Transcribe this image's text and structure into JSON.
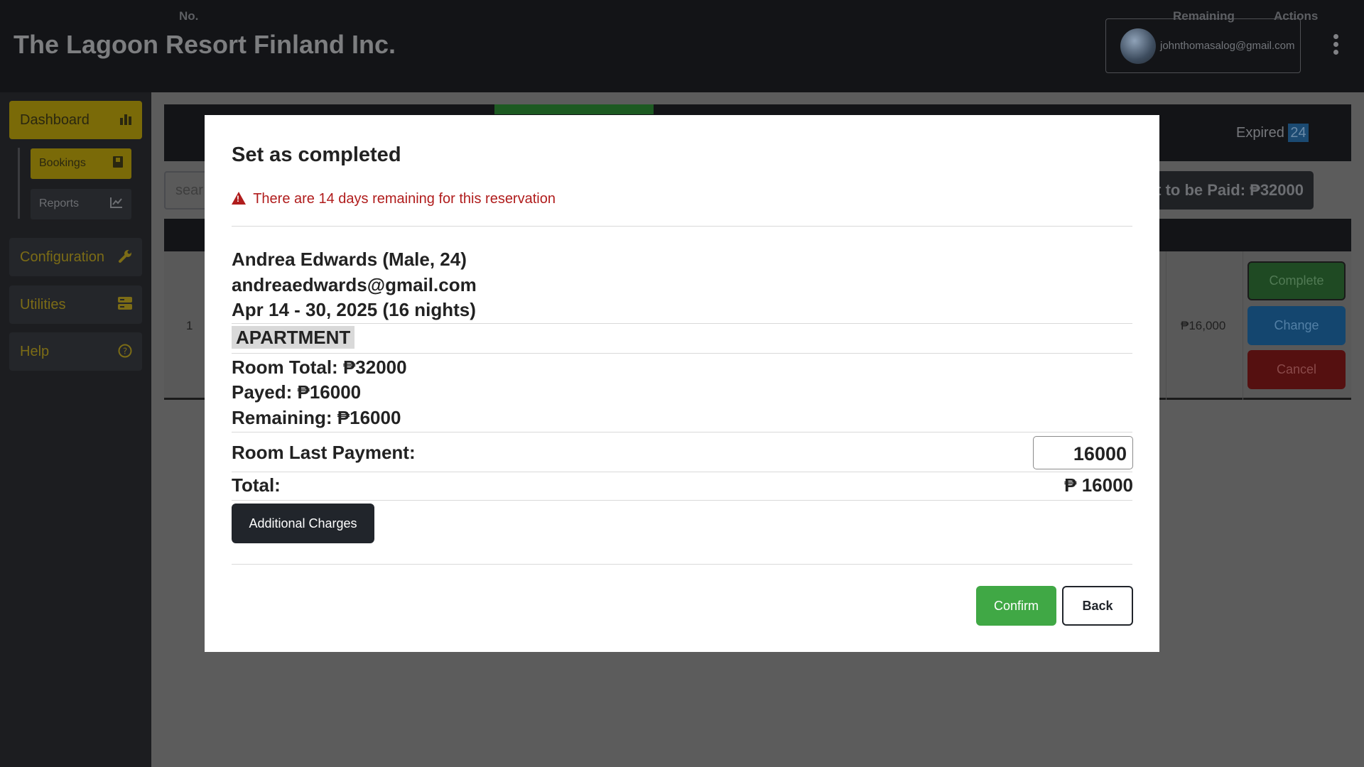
{
  "header": {
    "brand": "The Lagoon Resort Finland Inc.",
    "account_email": "johnthomasalog@gmail.com"
  },
  "sidebar": {
    "dashboard": "Dashboard",
    "bookings": "Bookings",
    "reports": "Reports",
    "configuration": "Configuration",
    "utilities": "Utilities",
    "help": "Help"
  },
  "main": {
    "expired_label": "Expired",
    "expired_count": "24",
    "search_placeholder": "sear",
    "amount_to_be_paid": "t to be Paid: ₱32000",
    "table_headers": {
      "no": "No.",
      "remaining": "Remaining",
      "actions": "Actions"
    },
    "row": {
      "no": "1",
      "remaining": "₱16,000",
      "actions": {
        "complete": "Complete",
        "change": "Change",
        "cancel": "Cancel"
      }
    }
  },
  "modal": {
    "title": "Set as completed",
    "alert": "There are 14 days remaining for this reservation",
    "guest_name": "Andrea Edwards (Male, 24)",
    "guest_email": "andreaedwards@gmail.com",
    "stay_dates": "Apr 14 - 30, 2025 (16 nights)",
    "room_type": "APARTMENT",
    "room_total": "Room Total: ₱32000",
    "payed": "Payed: ₱16000",
    "remaining": "Remaining: ₱16000",
    "last_payment_label": "Room Last Payment:",
    "last_payment_value": "16000",
    "total_label": "Total:",
    "total_value": "₱ 16000",
    "additional_charges": "Additional Charges",
    "confirm": "Confirm",
    "back": "Back"
  },
  "colors": {
    "alert": "#b01c1c",
    "confirm": "#40a845",
    "dark_button": "#21252b",
    "nav_active": "#7a6a08"
  }
}
